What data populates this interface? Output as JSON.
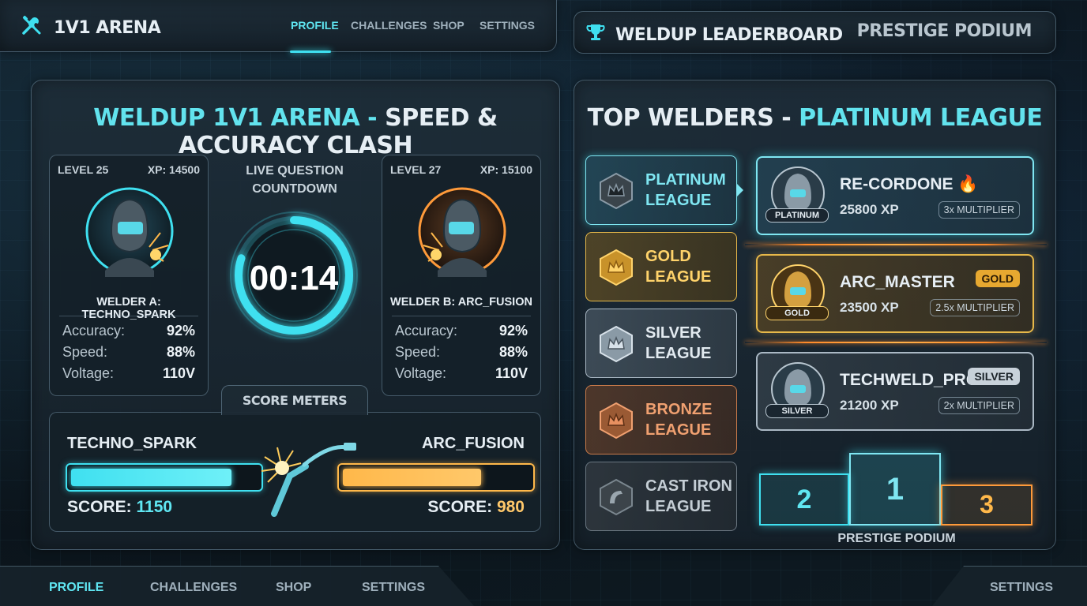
{
  "app": {
    "brand": "1V1 ARENA",
    "top_nav": [
      "PROFILE",
      "CHALLENGES",
      "SHOP",
      "SETTINGS"
    ],
    "active_tab": "PROFILE",
    "accent": "#3fe0f0",
    "gold": "#ffb84a"
  },
  "leaderboard_bar": {
    "title": "WELDUP LEADERBOARD",
    "subtitle": "PRESTIGE PODIUM"
  },
  "arena": {
    "title_prefix": "WELDUP 1V1 ARENA -",
    "title_suffix": "SPEED & ACCURACY CLASH",
    "player_a": {
      "level": "LEVEL 25",
      "xp": "XP: 14500",
      "name": "WELDER A: TECHNO_SPARK",
      "stats": [
        {
          "label": "Accuracy:",
          "value": "92%"
        },
        {
          "label": "Speed:",
          "value": "88%"
        },
        {
          "label": "Voltage:",
          "value": "110V"
        }
      ],
      "color": "#3fe0f0"
    },
    "player_b": {
      "level": "LEVEL 27",
      "xp": "XP: 15100",
      "name": "WELDER B: ARC_FUSION",
      "stats": [
        {
          "label": "Accuracy:",
          "value": "92%"
        },
        {
          "label": "Speed:",
          "value": "88%"
        },
        {
          "label": "Voltage:",
          "value": "110V"
        }
      ],
      "color": "#ff9a3a"
    },
    "countdown": {
      "label_line1": "LIVE QUESTION",
      "label_line2": "COUNTDOWN",
      "time": "00:14",
      "progress": 0.8
    },
    "score_meters": {
      "label": "SCORE METERS",
      "a_name": "TECHNO_SPARK",
      "a_score_label": "SCORE:",
      "a_score": "1150",
      "a_fill": 0.86,
      "b_name": "ARC_FUSION",
      "b_score_label": "SCORE:",
      "b_score": "980",
      "b_fill": 0.74
    }
  },
  "leader": {
    "title_prefix": "TOP WELDERS -",
    "title_suffix": "PLATINUM LEAGUE",
    "leagues": [
      {
        "line1": "PLATINUM",
        "line2": "LEAGUE",
        "key": "platinum",
        "color": "#7fe6f2"
      },
      {
        "line1": "GOLD",
        "line2": "LEAGUE",
        "key": "gold",
        "color": "#ffd36a"
      },
      {
        "line1": "SILVER",
        "line2": "LEAGUE",
        "key": "silver",
        "color": "#d8e2ea"
      },
      {
        "line1": "BRONZE",
        "line2": "LEAGUE",
        "key": "bronze",
        "color": "#f0a070"
      },
      {
        "line1": "CAST IRON",
        "line2": "LEAGUE",
        "key": "castiron",
        "color": "#c5ced5"
      }
    ],
    "ranks": [
      {
        "name": "RE-CORDONE",
        "xp": "25800 XP",
        "mult": "3x MULTIPLIER",
        "tag": "PLATINUM",
        "badge": ""
      },
      {
        "name": "ARC_MASTER",
        "xp": "23500 XP",
        "mult": "2.5x MULTIPLIER",
        "tag": "GOLD",
        "badge": "GOLD"
      },
      {
        "name": "TECHWELD_PRO",
        "xp": "21200 XP",
        "mult": "2x MULTIPLIER",
        "tag": "SILVER",
        "badge": "SILVER"
      }
    ],
    "podium": {
      "first": "1",
      "second": "2",
      "third": "3",
      "label": "PRESTIGE PODIUM"
    }
  },
  "bottom_nav": [
    "PROFILE",
    "CHALLENGES",
    "SHOP",
    "SETTINGS"
  ],
  "bottom_right": "SETTINGS"
}
